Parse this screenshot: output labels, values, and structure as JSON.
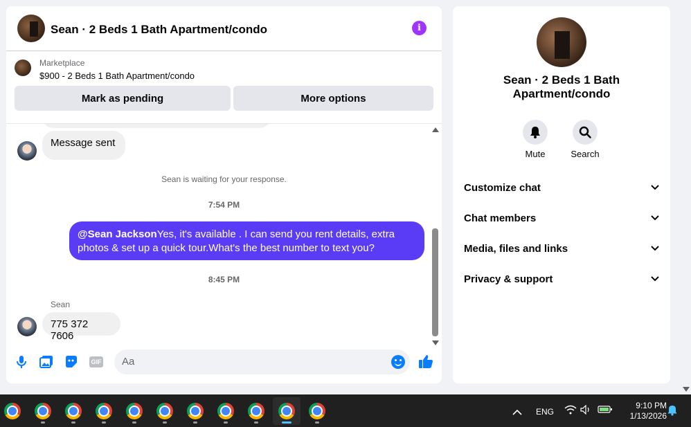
{
  "chat": {
    "title": "Sean · 2 Beds 1 Bath Apartment/condo",
    "listing_label": "Marketplace",
    "listing_price": "$900 - 2 Beds 1 Bath Apartment/condo",
    "mark_pending_label": "Mark as pending",
    "more_options_label": "More options"
  },
  "messages": {
    "sent_status": "Message sent",
    "waiting_notice": "Sean is waiting for your response.",
    "time1": "7:54 PM",
    "outgoing_mention": "@Sean Jackson",
    "outgoing_text": "Yes, it's available .  I can send you rent details, extra photos & set up a quick tour.What's the best number to text you?",
    "time2": "8:45 PM",
    "sender_name": "Sean",
    "incoming_text": "775 372 7606"
  },
  "composer": {
    "placeholder": "Aa",
    "gif_label": "GIF"
  },
  "sidebar": {
    "name": "Sean · 2 Beds 1 Bath Apartment/condo",
    "actions": [
      {
        "label": "Mute",
        "icon": "bell-icon"
      },
      {
        "label": "Search",
        "icon": "search-icon"
      }
    ],
    "sections": [
      {
        "label": "Customize chat"
      },
      {
        "label": "Chat members"
      },
      {
        "label": "Media, files and links"
      },
      {
        "label": "Privacy & support"
      }
    ]
  },
  "taskbar": {
    "lang": "ENG",
    "time": "9:10 PM",
    "date": "1/13/2026"
  },
  "colors": {
    "accent": "#5b3cf6",
    "messenger_blue": "#0a7cff",
    "info_purple": "#a033ff"
  }
}
